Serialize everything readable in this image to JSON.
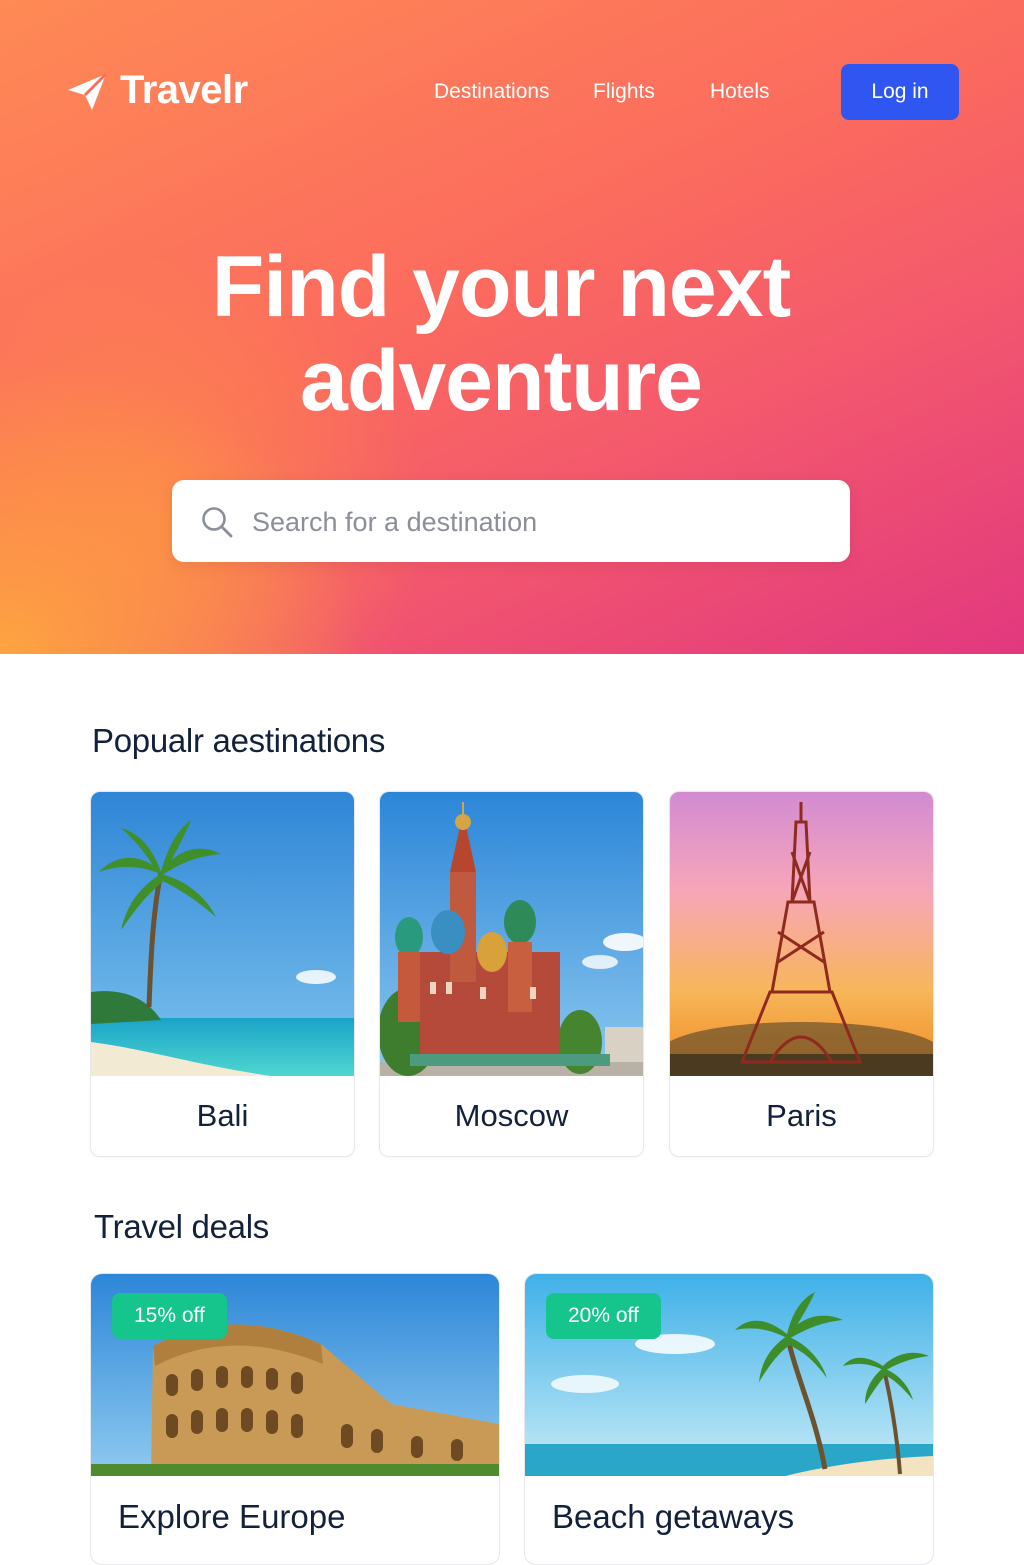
{
  "brand": {
    "name": "Travelr",
    "icon": "paper-plane-icon"
  },
  "nav": {
    "links": [
      "Destinations",
      "Flights",
      "Hotels"
    ],
    "login_label": "Log in"
  },
  "hero": {
    "title_line1": "Find your next",
    "title_line2": "adventure",
    "search_placeholder": "Search for a destination"
  },
  "popular": {
    "title": "Popualr aestinations",
    "cards": [
      {
        "name": "Bali",
        "image": "tropical-beach-palm-image"
      },
      {
        "name": "Moscow",
        "image": "saint-basils-cathedral-image"
      },
      {
        "name": "Paris",
        "image": "eiffel-tower-sunset-image"
      }
    ]
  },
  "deals": {
    "title": "Travel deals",
    "cards": [
      {
        "badge": "15% off",
        "title": "Explore Europe",
        "image": "colosseum-image"
      },
      {
        "badge": "20% off",
        "title": "Beach getaways",
        "image": "palm-beach-image"
      }
    ]
  },
  "colors": {
    "hero_gradient": [
      "#ff8a55",
      "#f45a6c",
      "#e2387f"
    ],
    "login_button": "#2f56f0",
    "deal_badge": "#16c58b",
    "text_dark": "#14213a"
  }
}
